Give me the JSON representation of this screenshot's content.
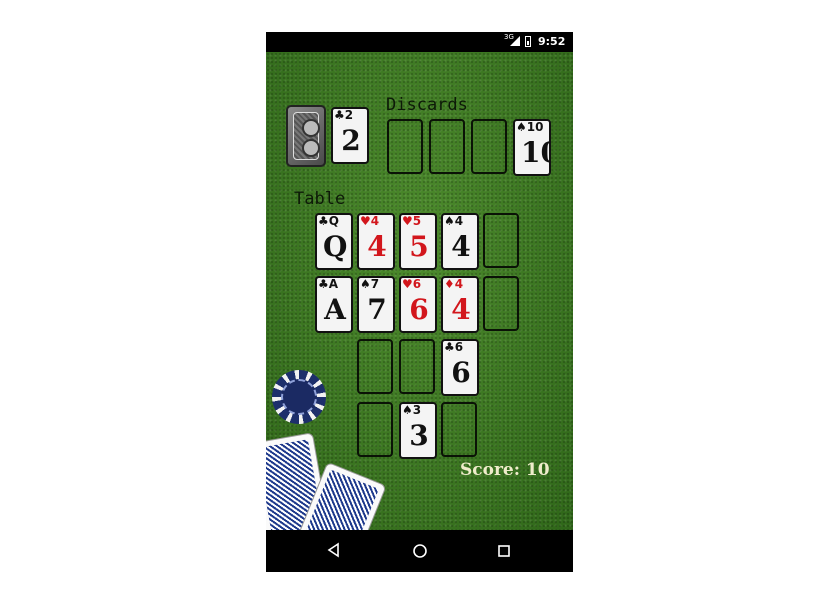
{
  "status_bar": {
    "network": "3G",
    "time": "9:52"
  },
  "labels": {
    "discards": "Discards",
    "table": "Table"
  },
  "stock": {
    "top_card": {
      "rank": "2",
      "suit": "♣",
      "color": "black"
    }
  },
  "discards": [
    {
      "empty": true
    },
    {
      "empty": true
    },
    {
      "empty": true
    },
    {
      "rank": "10",
      "suit": "♠",
      "color": "black"
    }
  ],
  "table": [
    [
      {
        "rank": "Q",
        "suit": "♣",
        "color": "black"
      },
      {
        "rank": "4",
        "suit": "♥",
        "color": "red"
      },
      {
        "rank": "5",
        "suit": "♥",
        "color": "red"
      },
      {
        "rank": "4",
        "suit": "♠",
        "color": "black"
      },
      {
        "empty": true
      }
    ],
    [
      {
        "rank": "A",
        "suit": "♣",
        "color": "black"
      },
      {
        "rank": "7",
        "suit": "♠",
        "color": "black"
      },
      {
        "rank": "6",
        "suit": "♥",
        "color": "red"
      },
      {
        "rank": "4",
        "suit": "♦",
        "color": "red"
      },
      {
        "empty": true
      }
    ],
    [
      {
        "hidden": true
      },
      {
        "empty": true
      },
      {
        "empty": true
      },
      {
        "rank": "6",
        "suit": "♣",
        "color": "black"
      },
      {
        "hidden": true
      }
    ],
    [
      {
        "hidden": true
      },
      {
        "empty": true
      },
      {
        "rank": "3",
        "suit": "♠",
        "color": "black"
      },
      {
        "empty": true
      },
      {
        "hidden": true
      }
    ]
  ],
  "score": {
    "text": "Score: 10"
  },
  "nav": {
    "back": "back-icon",
    "home": "home-icon",
    "recent": "recent-apps-icon"
  },
  "colors": {
    "felt": "#3f7a23",
    "score_text": "#efeccb",
    "red_suit": "#d2161c",
    "chip_blue": "#1d2f6b",
    "deck_blue": "#1f3a8c"
  }
}
